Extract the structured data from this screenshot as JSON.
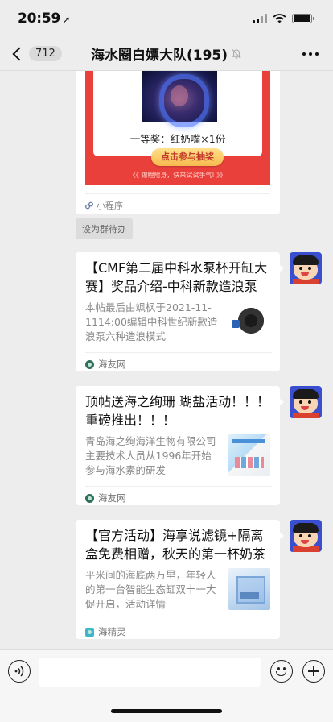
{
  "status_bar": {
    "time": "20:59",
    "location_arrow": "➚"
  },
  "nav": {
    "back_count": "712",
    "title": "海水圈白嫖大队(195)",
    "mute_icon": "bell-slash-icon",
    "more_icon": "more-dots-icon"
  },
  "messages": {
    "mini_program": {
      "prize_text": "一等奖：红奶嘴×1份",
      "draw_button": "点击参与抽奖",
      "hint_text": "《《  锦鲤附身，快来试试手气!  》》",
      "footer_label": "小程序"
    },
    "todo_tag": "设为群待办",
    "links": [
      {
        "title": "【CMF第二届中科水泵杯开缸大赛】奖品介绍-中科新款造浪泵",
        "description": "本帖最后由飒枫于2021-11-1114:00编辑中科世纪新款造浪泵六种造浪模式",
        "source": "海友网"
      },
      {
        "title": "顶帖送海之绚珊 瑚盐活动！！！ 重磅推出！！！",
        "description": "青岛海之绚海洋生物有限公司主要技术人员从1996年开始参与海水素的研发",
        "source": "海友网"
      },
      {
        "title": "【官方活动】海享说滤镜+隔离盒免费相赠，秋天的第一杯奶茶",
        "description": "平米间的海底两万里，年轻人的第一台智能生态缸双十一大促开启，活动详情",
        "source": "海精灵"
      }
    ]
  },
  "colors": {
    "background": "#ededed",
    "card_red": "#e9403c",
    "draw_button": "#f6b94d"
  }
}
